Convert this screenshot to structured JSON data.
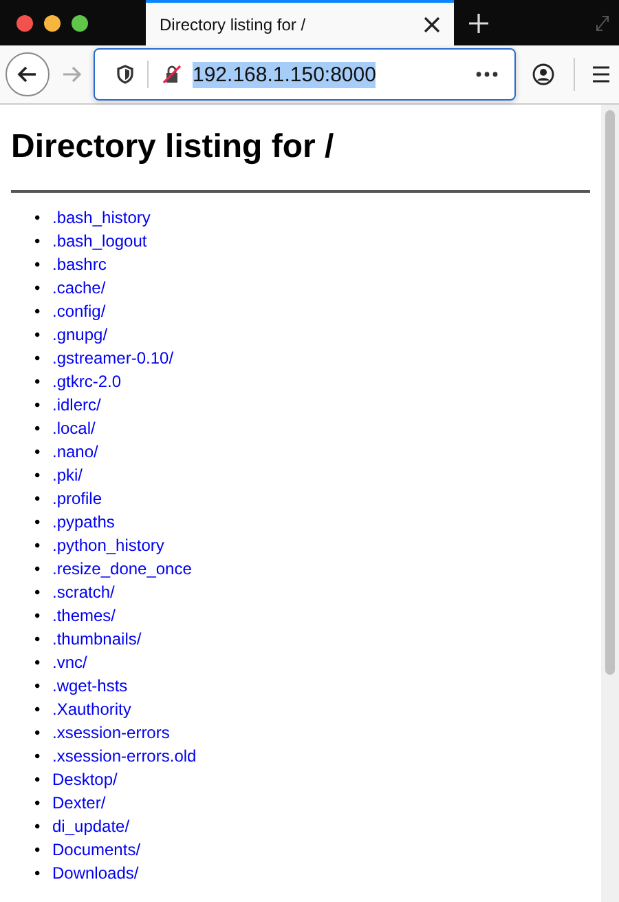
{
  "window": {
    "tab": {
      "title": "Directory listing for /",
      "selected": true
    }
  },
  "toolbar": {
    "url": "192.168.1.150:8000"
  },
  "page": {
    "heading": "Directory listing for /",
    "links": [
      {
        "bullet": "•",
        "name": ".bash_history"
      },
      {
        "bullet": "•",
        "name": ".bash_logout"
      },
      {
        "bullet": "•",
        "name": ".bashrc"
      },
      {
        "bullet": "•",
        "name": ".cache/"
      },
      {
        "bullet": "•",
        "name": ".config/"
      },
      {
        "bullet": "•",
        "name": ".gnupg/"
      },
      {
        "bullet": "•",
        "name": ".gstreamer-0.10/"
      },
      {
        "bullet": "•",
        "name": ".gtkrc-2.0"
      },
      {
        "bullet": "•",
        "name": ".idlerc/"
      },
      {
        "bullet": "•",
        "name": ".local/"
      },
      {
        "bullet": "•",
        "name": ".nano/"
      },
      {
        "bullet": "•",
        "name": ".pki/"
      },
      {
        "bullet": "•",
        "name": ".profile"
      },
      {
        "bullet": "•",
        "name": ".pypaths"
      },
      {
        "bullet": "•",
        "name": ".python_history"
      },
      {
        "bullet": "•",
        "name": ".resize_done_once"
      },
      {
        "bullet": "•",
        "name": ".scratch/"
      },
      {
        "bullet": "•",
        "name": ".themes/"
      },
      {
        "bullet": "•",
        "name": ".thumbnails/"
      },
      {
        "bullet": "•",
        "name": ".vnc/"
      },
      {
        "bullet": "•",
        "name": ".wget-hsts"
      },
      {
        "bullet": "•",
        "name": ".Xauthority"
      },
      {
        "bullet": "•",
        "name": ".xsession-errors"
      },
      {
        "bullet": "•",
        "name": ".xsession-errors.old"
      },
      {
        "bullet": "•",
        "name": "Desktop/"
      },
      {
        "bullet": "•",
        "name": "Dexter/"
      },
      {
        "bullet": "•",
        "name": "di_update/"
      },
      {
        "bullet": "•",
        "name": "Documents/"
      },
      {
        "bullet": "•",
        "name": "Downloads/"
      }
    ]
  }
}
